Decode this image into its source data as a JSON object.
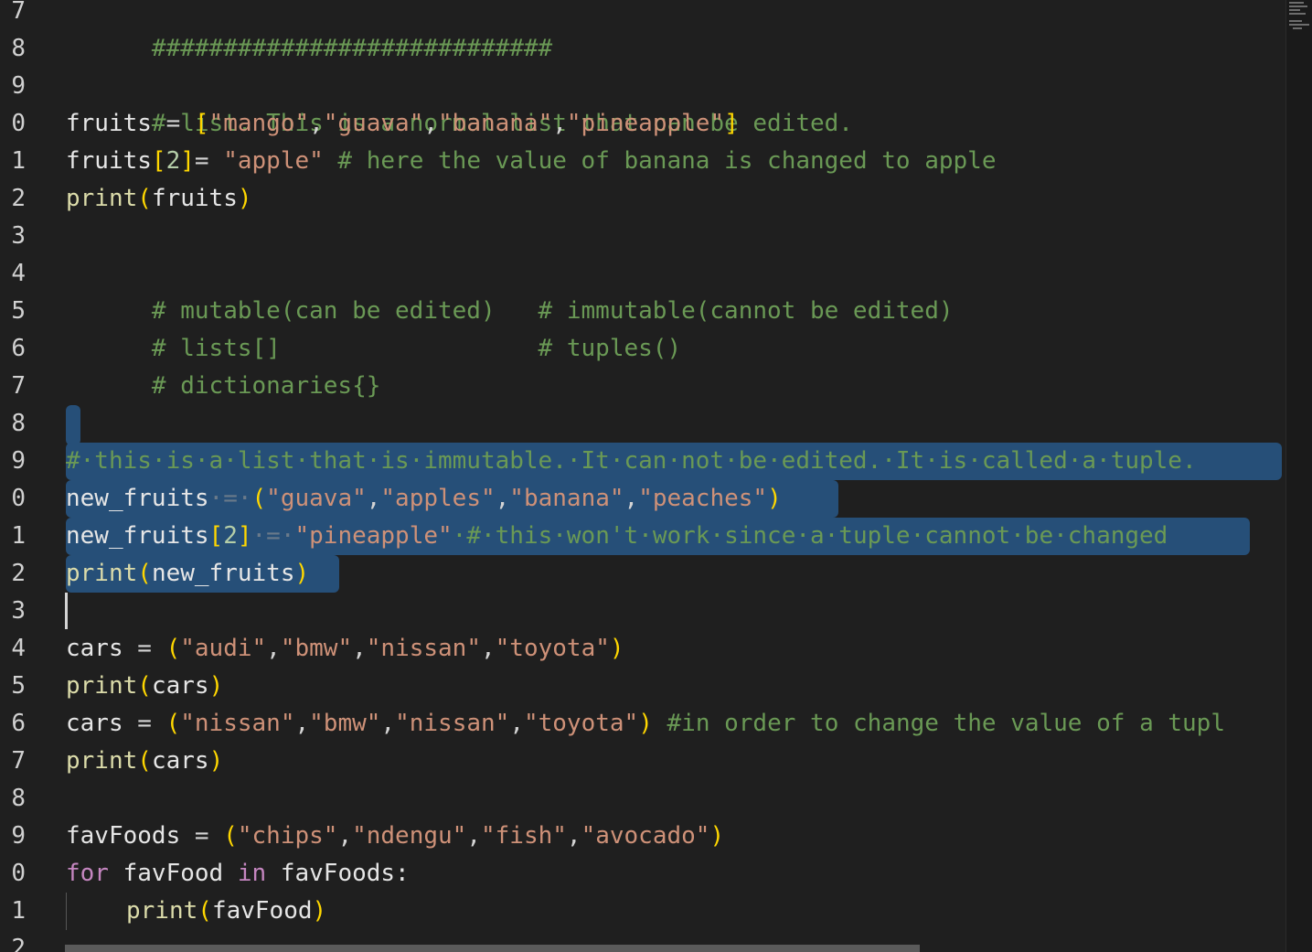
{
  "editor": {
    "language": "python",
    "colors": {
      "background": "#1f1f1f",
      "selection": "#264f78",
      "string": "#ce9178",
      "comment": "#6a9955",
      "keyword": "#c586c0",
      "function": "#dcdcaa",
      "bracket": "#ffd700"
    },
    "line_numbers": [
      "7",
      "8",
      "9",
      "0",
      "1",
      "2",
      "3",
      "4",
      "5",
      "6",
      "7",
      "8",
      "9",
      "0",
      "1",
      "2",
      "3",
      "4",
      "5",
      "6",
      "7",
      "8",
      "9",
      "0",
      "1",
      "2"
    ],
    "lines": {
      "l0": {
        "comment": "############################"
      },
      "l2": {
        "comment": "# list. This is a normal list that can be edited."
      },
      "l3": {
        "var": "fruits",
        "op": " = ",
        "s1": "\"mango\"",
        "s2": "\"guava\"",
        "s3": "\"banana\"",
        "s4": "\"pineapple\""
      },
      "l4": {
        "var": "fruits",
        "idx": "2",
        "op": "= ",
        "str": "\"apple\"",
        "comment": " # here the value of banana is changed to apple"
      },
      "l5": {
        "fn": "print",
        "arg": "fruits"
      },
      "l7": {
        "comment": "# mutable(can be edited)   # immutable(cannot be edited)"
      },
      "l8": {
        "comment": "# lists[]                  # tuples()"
      },
      "l9": {
        "comment": "# dictionaries{}"
      },
      "l12": {
        "comment": "#·this·is·a·list·that·is·immutable.·It·can·not·be·edited.·It·is·called·a·tuple."
      },
      "l13": {
        "var": "new_fruits",
        "op": "·=·",
        "s1": "\"guava\"",
        "s2": "\"apples\"",
        "s3": "\"banana\"",
        "s4": "\"peaches\""
      },
      "l14": {
        "var": "new_fruits",
        "idx": "2",
        "op": "·=·",
        "str": "\"pineapple\"",
        "comment": "·#·this·won't·work·since·a·tuple·cannot·be·changed"
      },
      "l15": {
        "fn": "print",
        "arg": "new_fruits"
      },
      "l17": {
        "var": "cars",
        "op": " = ",
        "s1": "\"audi\"",
        "s2": "\"bmw\"",
        "s3": "\"nissan\"",
        "s4": "\"toyota\""
      },
      "l18": {
        "fn": "print",
        "arg": "cars"
      },
      "l19": {
        "var": "cars",
        "op": " = ",
        "s1": "\"nissan\"",
        "s2": "\"bmw\"",
        "s3": "\"nissan\"",
        "s4": "\"toyota\"",
        "comment": " #in order to change the value of a tupl"
      },
      "l20": {
        "fn": "print",
        "arg": "cars"
      },
      "l22": {
        "var": "favFoods",
        "op": " = ",
        "s1": "\"chips\"",
        "s2": "\"ndengu\"",
        "s3": "\"fish\"",
        "s4": "\"avocado\""
      },
      "l23": {
        "kw1": "for",
        "var": " favFood ",
        "kw2": "in",
        "var2": " favFoods:"
      },
      "l24": {
        "fn": "print",
        "arg": "favFood"
      }
    }
  }
}
